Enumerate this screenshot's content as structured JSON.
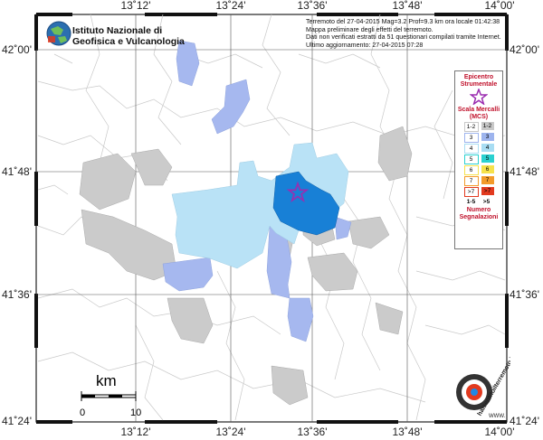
{
  "header": {
    "line1": "Terremoto del 27-04-2015 Mag=3.2 Prof=9.3 km ora locale 01:42:38",
    "line2": "Mappa preliminare degli effetti del terremoto.",
    "line3": "Dati non verificati estratti da 51 questionari compilati tramite Internet.",
    "line4": "Ultimo aggiornamento: 27-04-2015 07:28"
  },
  "institute": {
    "line1": "Istituto Nazionale di",
    "line2": "Geofisica e Vulcanologia"
  },
  "axes": {
    "lon_labels": [
      "13˚12'",
      "13˚24'",
      "13˚36'",
      "13˚48'",
      "14˚00'"
    ],
    "lat_labels": [
      "42˚00'",
      "41˚48'",
      "41˚36'",
      "41˚24'"
    ]
  },
  "legend": {
    "epicentre_title": "Epicentro Strumentale",
    "scale_title": "Scala Mercalli (MCS)",
    "rows": [
      {
        "l": "1-2",
        "r": "1-2",
        "color": "#c8c8c8"
      },
      {
        "l": "3",
        "r": "3",
        "color": "#9db4ee"
      },
      {
        "l": "4",
        "r": "4",
        "color": "#a8ddf3"
      },
      {
        "l": "5",
        "r": "5",
        "color": "#2ad1d0"
      },
      {
        "l": "6",
        "r": "6",
        "color": "#f6e24b"
      },
      {
        "l": "7",
        "r": "7",
        "color": "#f39b2a"
      },
      {
        "l": ">7",
        "r": ">7",
        "color": "#e23a1f"
      }
    ],
    "count_l": "1-5",
    "count_r": ">5",
    "count_title": "Numero Segnalazioni"
  },
  "scalebar": {
    "unit": "km",
    "start": "0",
    "end": "10"
  },
  "brand": {
    "text": "haisentitoilterremoto.it",
    "sub": "WWW."
  },
  "colors": {
    "gray": "#cbcbcb",
    "level3": "#a6b8ef",
    "level4": "#b9e2f6",
    "level_dark": "#1880d6"
  }
}
